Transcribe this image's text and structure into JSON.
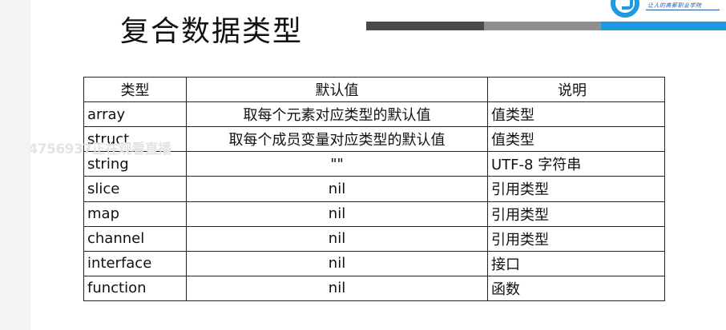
{
  "slide": {
    "title": "复合数据类型",
    "logo_text": "让人的高薪职业学院",
    "watermark": "44756937正在观看直播"
  },
  "table": {
    "headers": [
      "类型",
      "默认值",
      "说明"
    ],
    "rows": [
      {
        "type": "array",
        "default": "取每个元素对应类型的默认值",
        "desc": "值类型"
      },
      {
        "type": "struct",
        "default": "取每个成员变量对应类型的默认值",
        "desc": "值类型"
      },
      {
        "type": "string",
        "default": "\"\"",
        "desc": "UTF-8 字符串"
      },
      {
        "type": "slice",
        "default": "nil",
        "desc": "引用类型"
      },
      {
        "type": "map",
        "default": "nil",
        "desc": "引用类型"
      },
      {
        "type": "channel",
        "default": "nil",
        "desc": "引用类型"
      },
      {
        "type": "interface",
        "default": "nil",
        "desc": "接口"
      },
      {
        "type": "function",
        "default": "nil",
        "desc": "函数"
      }
    ]
  },
  "colors": {
    "bar_dark": "#4a4a4a",
    "bar_grey": "#8f8f8f",
    "bar_blue": "#1e9be0"
  }
}
